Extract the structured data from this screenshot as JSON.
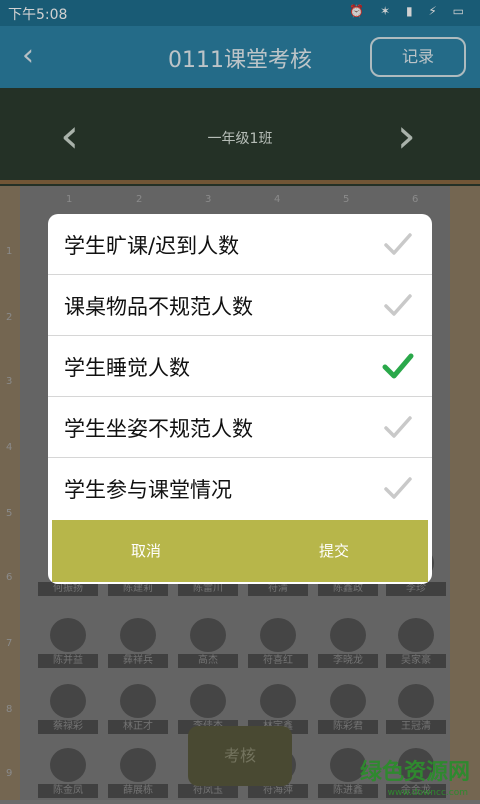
{
  "status": {
    "time": "下午5:08",
    "icons": "⏰ ✶ ▮ ⚡ ▭"
  },
  "appbar": {
    "title": "0111课堂考核",
    "record_label": "记录",
    "back_icon": "chevron-left-icon"
  },
  "board": {
    "class_name": "一年级1班"
  },
  "grid": {
    "columns": [
      "1",
      "2",
      "3",
      "4",
      "5",
      "6"
    ],
    "rows": [
      "1",
      "2",
      "3",
      "4",
      "5",
      "6",
      "7",
      "8",
      "9"
    ],
    "row6_names": [
      "何振扬",
      "陈建莉",
      "陈雷川",
      "符清",
      "陈鑫政",
      "李珍"
    ],
    "row7_names": [
      "陈并益",
      "彝祥兵",
      "高杰",
      "符喜红",
      "李晓龙",
      "吴家豪"
    ],
    "row8_names": [
      "蔡禄彩",
      "林正才",
      "李佳杰",
      "林宇鑫",
      "陈彩君",
      "王冠清"
    ],
    "row9_names": [
      "陈金凤",
      "薛展栋",
      "符凤玉",
      "符海萍",
      "陈进鑫",
      "余金龙"
    ]
  },
  "dialog": {
    "options": [
      {
        "label": "学生旷课/迟到人数",
        "checked": false
      },
      {
        "label": "课桌物品不规范人数",
        "checked": false
      },
      {
        "label": "学生睡觉人数",
        "checked": true
      },
      {
        "label": "学生坐姿不规范人数",
        "checked": false
      },
      {
        "label": "学生参与课堂情况",
        "checked": false
      }
    ],
    "cancel_label": "取消",
    "submit_label": "提交"
  },
  "exam_button": "考核",
  "watermark": {
    "text": "绿色资源网",
    "url": "www.downcc.com"
  },
  "colors": {
    "appbar": "#2d83a6",
    "accent_bar": "#b7b64a",
    "check_on": "#2aa84a",
    "check_off": "#c9c9c9"
  }
}
